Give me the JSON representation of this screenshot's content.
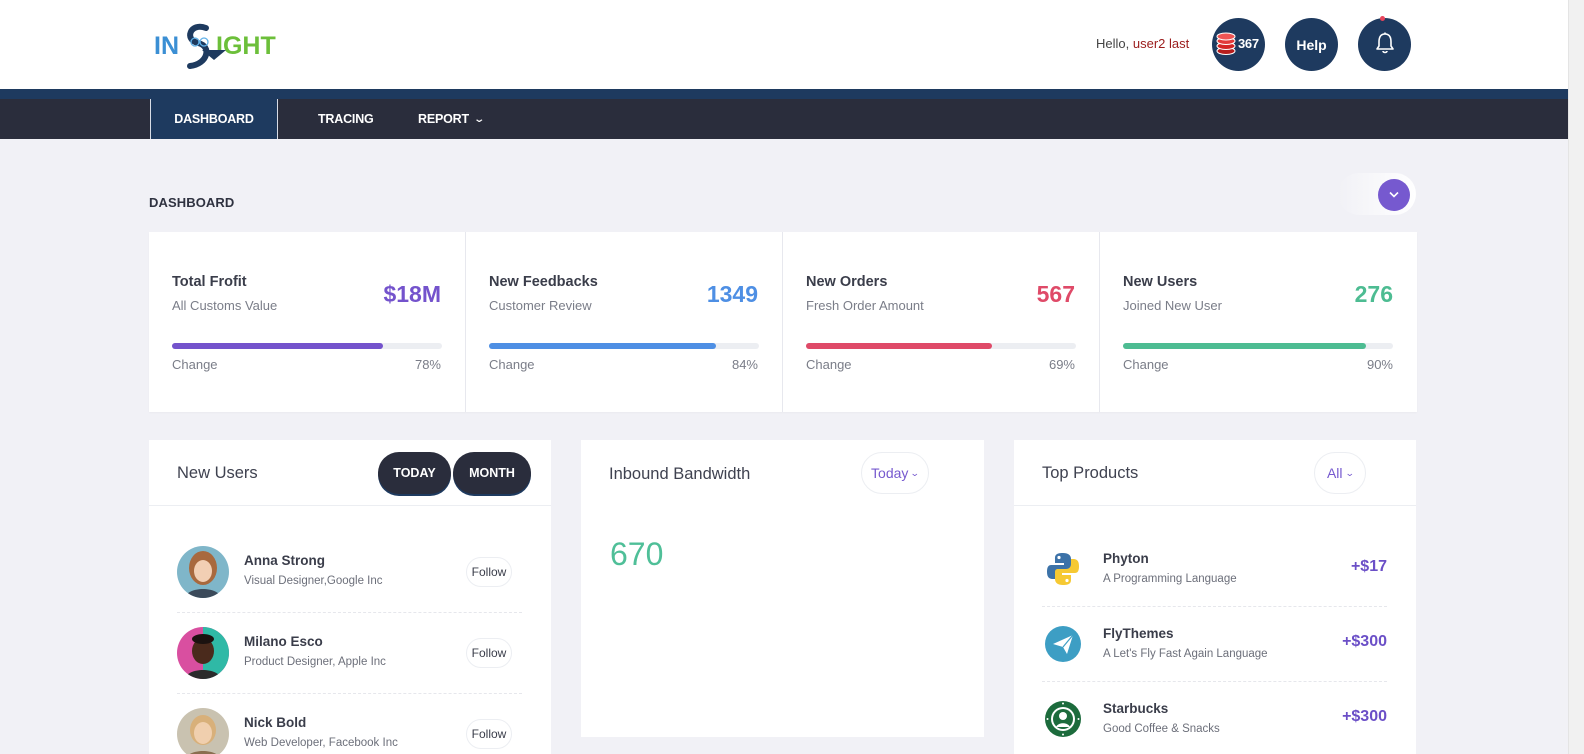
{
  "header": {
    "logo_text": "INSIGHT",
    "greeting": "Hello, ",
    "username": "user2 last",
    "coins_count": "367",
    "help_label": "Help"
  },
  "nav": {
    "items": [
      {
        "label": "DASHBOARD",
        "active": true
      },
      {
        "label": "TRACING"
      },
      {
        "label": "REPORT"
      }
    ]
  },
  "page": {
    "title": "DASHBOARD"
  },
  "stats": [
    {
      "title": "Total Frofit",
      "subtitle": "All Customs Value",
      "value": "$18M",
      "change_label": "Change",
      "percent": "78%",
      "progress": 0.78,
      "color": "#7453cc"
    },
    {
      "title": "New Feedbacks",
      "subtitle": "Customer Review",
      "value": "1349",
      "change_label": "Change",
      "percent": "84%",
      "progress": 0.84,
      "color": "#4e8fe4"
    },
    {
      "title": "New Orders",
      "subtitle": "Fresh Order Amount",
      "value": "567",
      "change_label": "Change",
      "percent": "69%",
      "progress": 0.69,
      "color": "#df4a68"
    },
    {
      "title": "New Users",
      "subtitle": "Joined New User",
      "value": "276",
      "change_label": "Change",
      "percent": "90%",
      "progress": 0.9,
      "color": "#4dbc92"
    }
  ],
  "new_users": {
    "title": "New Users",
    "tab_today": "TODAY",
    "tab_month": "MONTH",
    "follow_label": "Follow",
    "users": [
      {
        "name": "Anna Strong",
        "role": "Visual Designer,Google Inc"
      },
      {
        "name": "Milano Esco",
        "role": "Product Designer, Apple Inc"
      },
      {
        "name": "Nick Bold",
        "role": "Web Developer, Facebook Inc"
      }
    ]
  },
  "bandwidth": {
    "title": "Inbound Bandwidth",
    "filter": "Today",
    "value": "670"
  },
  "top_products": {
    "title": "Top Products",
    "filter": "All",
    "items": [
      {
        "name": "Phyton",
        "desc": "A Programming Language",
        "amount": "+$17",
        "icon": "python-icon"
      },
      {
        "name": "FlyThemes",
        "desc": "A Let's Fly Fast Again Language",
        "amount": "+$300",
        "icon": "paper-plane-icon"
      },
      {
        "name": "Starbucks",
        "desc": "Good Coffee & Snacks",
        "amount": "+$300",
        "icon": "starbucks-icon"
      }
    ]
  },
  "colors": {
    "navy": "#1e3a5f",
    "nav_dark": "#2a2d3c",
    "accent_purple": "#7659cf",
    "green": "#4fbf98"
  }
}
